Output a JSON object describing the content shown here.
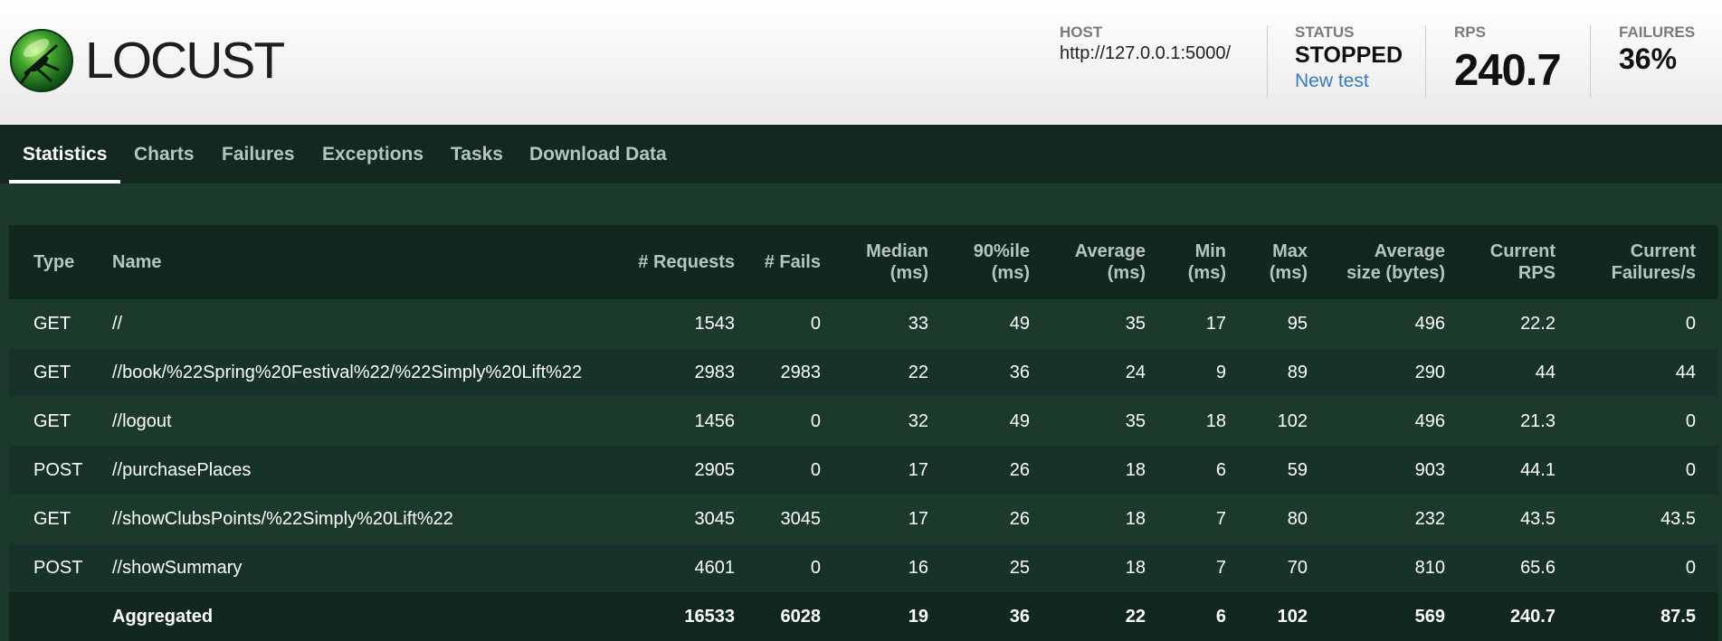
{
  "app": {
    "logo_text": "LOCUST"
  },
  "header": {
    "host_label": "HOST",
    "host_value": "http://127.0.0.1:5000/",
    "status_label": "STATUS",
    "status_value": "STOPPED",
    "new_test_label": "New test",
    "rps_label": "RPS",
    "rps_value": "240.7",
    "failures_label": "FAILURES",
    "failures_value": "36%"
  },
  "tabs": [
    {
      "label": "Statistics",
      "active": true
    },
    {
      "label": "Charts",
      "active": false
    },
    {
      "label": "Failures",
      "active": false
    },
    {
      "label": "Exceptions",
      "active": false
    },
    {
      "label": "Tasks",
      "active": false
    },
    {
      "label": "Download Data",
      "active": false
    }
  ],
  "table": {
    "headers": {
      "type": "Type",
      "name": "Name",
      "requests": "# Requests",
      "fails": "# Fails",
      "median_1": "Median",
      "median_2": "(ms)",
      "p90_1": "90%ile",
      "p90_2": "(ms)",
      "avg_1": "Average",
      "avg_2": "(ms)",
      "min_1": "Min",
      "min_2": "(ms)",
      "max_1": "Max",
      "max_2": "(ms)",
      "size_1": "Average",
      "size_2": "size (bytes)",
      "rps_1": "Current",
      "rps_2": "RPS",
      "fps_1": "Current",
      "fps_2": "Failures/s"
    },
    "rows": [
      {
        "type": "GET",
        "name": "//",
        "requests": "1543",
        "fails": "0",
        "median": "33",
        "p90": "49",
        "avg": "35",
        "min": "17",
        "max": "95",
        "size": "496",
        "rps": "22.2",
        "fps": "0"
      },
      {
        "type": "GET",
        "name": "//book/%22Spring%20Festival%22/%22Simply%20Lift%22",
        "requests": "2983",
        "fails": "2983",
        "median": "22",
        "p90": "36",
        "avg": "24",
        "min": "9",
        "max": "89",
        "size": "290",
        "rps": "44",
        "fps": "44"
      },
      {
        "type": "GET",
        "name": "//logout",
        "requests": "1456",
        "fails": "0",
        "median": "32",
        "p90": "49",
        "avg": "35",
        "min": "18",
        "max": "102",
        "size": "496",
        "rps": "21.3",
        "fps": "0"
      },
      {
        "type": "POST",
        "name": "//purchasePlaces",
        "requests": "2905",
        "fails": "0",
        "median": "17",
        "p90": "26",
        "avg": "18",
        "min": "6",
        "max": "59",
        "size": "903",
        "rps": "44.1",
        "fps": "0"
      },
      {
        "type": "GET",
        "name": "//showClubsPoints/%22Simply%20Lift%22",
        "requests": "3045",
        "fails": "3045",
        "median": "17",
        "p90": "26",
        "avg": "18",
        "min": "7",
        "max": "80",
        "size": "232",
        "rps": "43.5",
        "fps": "43.5"
      },
      {
        "type": "POST",
        "name": "//showSummary",
        "requests": "4601",
        "fails": "0",
        "median": "16",
        "p90": "25",
        "avg": "18",
        "min": "7",
        "max": "70",
        "size": "810",
        "rps": "65.6",
        "fps": "0"
      }
    ],
    "aggregated": {
      "type": "",
      "name": "Aggregated",
      "requests": "16533",
      "fails": "6028",
      "median": "19",
      "p90": "36",
      "avg": "22",
      "min": "6",
      "max": "102",
      "size": "569",
      "rps": "240.7",
      "fps": "87.5"
    }
  }
}
